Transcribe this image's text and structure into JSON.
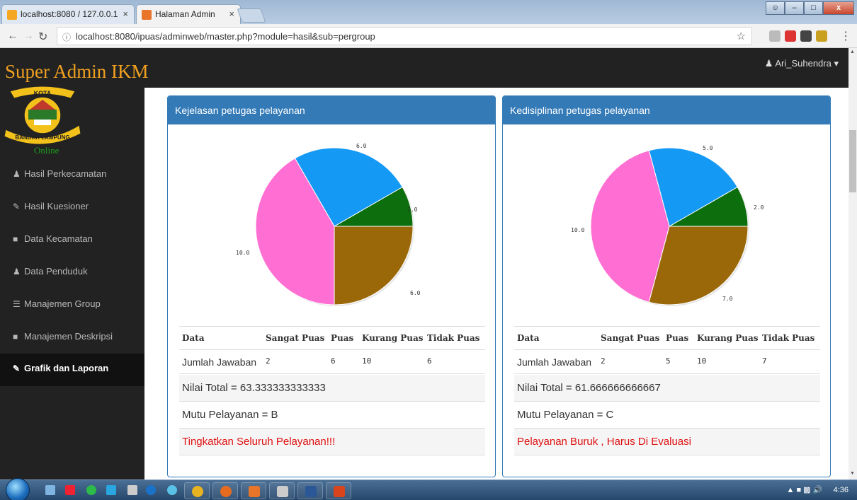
{
  "browser": {
    "tabs": [
      {
        "title": "localhost:8080 / 127.0.0.1"
      },
      {
        "title": "Halaman Admin"
      }
    ],
    "url": "localhost:8080/ipuas/adminweb/master.php?module=hasil&sub=pergroup"
  },
  "header": {
    "brand": "Super Admin IKM",
    "user": "Ari_Suhendra"
  },
  "sidebar": {
    "status": "Online",
    "items": [
      {
        "label": "Hasil Perkecamatan",
        "icon": "user-icon"
      },
      {
        "label": "Hasil Kuesioner",
        "icon": "edit-icon"
      },
      {
        "label": "Data Kecamatan",
        "icon": "book-icon"
      },
      {
        "label": "Data Penduduk",
        "icon": "user-icon"
      },
      {
        "label": "Manajemen Group",
        "icon": "list-icon"
      },
      {
        "label": "Manajemen Deskripsi",
        "icon": "book-icon"
      },
      {
        "label": "Grafik dan Laporan",
        "icon": "edit-icon",
        "active": true
      }
    ]
  },
  "panels": [
    {
      "title": "Kejelasan petugas pelayanan",
      "headers": [
        "Data",
        "Sangat Puas",
        "Puas",
        "Kurang Puas",
        "Tidak Puas"
      ],
      "row": {
        "label": "Jumlah Jawaban",
        "values": [
          "2",
          "6",
          "10",
          "6"
        ]
      },
      "total": "Nilai Total = 63.333333333333",
      "mutu": "Mutu Pelayanan = B",
      "message": "Tingkatkan Seluruh Pelayanan!!!",
      "slice_labels": [
        "2.0",
        "6.0",
        "10.0",
        "6.0"
      ]
    },
    {
      "title": "Kedisiplinan petugas pelayanan",
      "headers": [
        "Data",
        "Sangat Puas",
        "Puas",
        "Kurang Puas",
        "Tidak Puas"
      ],
      "row": {
        "label": "Jumlah Jawaban",
        "values": [
          "2",
          "5",
          "10",
          "7"
        ]
      },
      "total": "Nilai Total = 61.666666666667",
      "mutu": "Mutu Pelayanan = C",
      "message": "Pelayanan Buruk , Harus Di Evaluasi",
      "slice_labels": [
        "2.0",
        "5.0",
        "10.0",
        "7.0"
      ]
    }
  ],
  "chart_data": [
    {
      "type": "pie",
      "categories": [
        "Sangat Puas",
        "Puas",
        "Kurang Puas",
        "Tidak Puas"
      ],
      "values": [
        2,
        6,
        10,
        6
      ],
      "colors": [
        "#0d6e0d",
        "#1499f5",
        "#ff6ed2",
        "#9a6808"
      ]
    },
    {
      "type": "pie",
      "categories": [
        "Sangat Puas",
        "Puas",
        "Kurang Puas",
        "Tidak Puas"
      ],
      "values": [
        2,
        5,
        10,
        7
      ],
      "colors": [
        "#0d6e0d",
        "#1499f5",
        "#ff6ed2",
        "#9a6808"
      ]
    }
  ],
  "taskbar": {
    "time": "4:36"
  }
}
